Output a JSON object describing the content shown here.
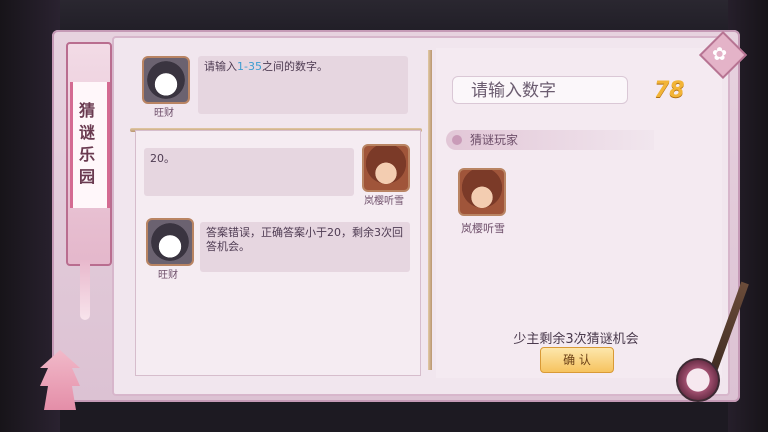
{
  "banner": {
    "title_chars": [
      "猜",
      "谜",
      "乐",
      "园"
    ]
  },
  "chat": {
    "messages": [
      {
        "sender": "旺财",
        "avatar": "husky-dog",
        "parts": [
          "请输入",
          "1-35",
          "之间的数字。"
        ]
      },
      {
        "sender": "岚樱听雪",
        "avatar": "girl-red-hair",
        "text": "20。"
      },
      {
        "sender": "旺财",
        "avatar": "husky-dog",
        "text": "答案错误，正确答案小于20，剩余3次回答机会。"
      }
    ]
  },
  "input": {
    "placeholder": "请输入数字"
  },
  "countdown": "78",
  "players": {
    "section_label": "猜谜玩家",
    "list": [
      {
        "name": "岚樱听雪",
        "avatar": "girl-red-hair"
      }
    ]
  },
  "remaining_text": "少主剩余3次猜谜机会",
  "confirm_label": "确 认",
  "colors": {
    "accent": "#f2b437",
    "highlight": "#3d9dd1",
    "panel": "#f1e6ee"
  }
}
